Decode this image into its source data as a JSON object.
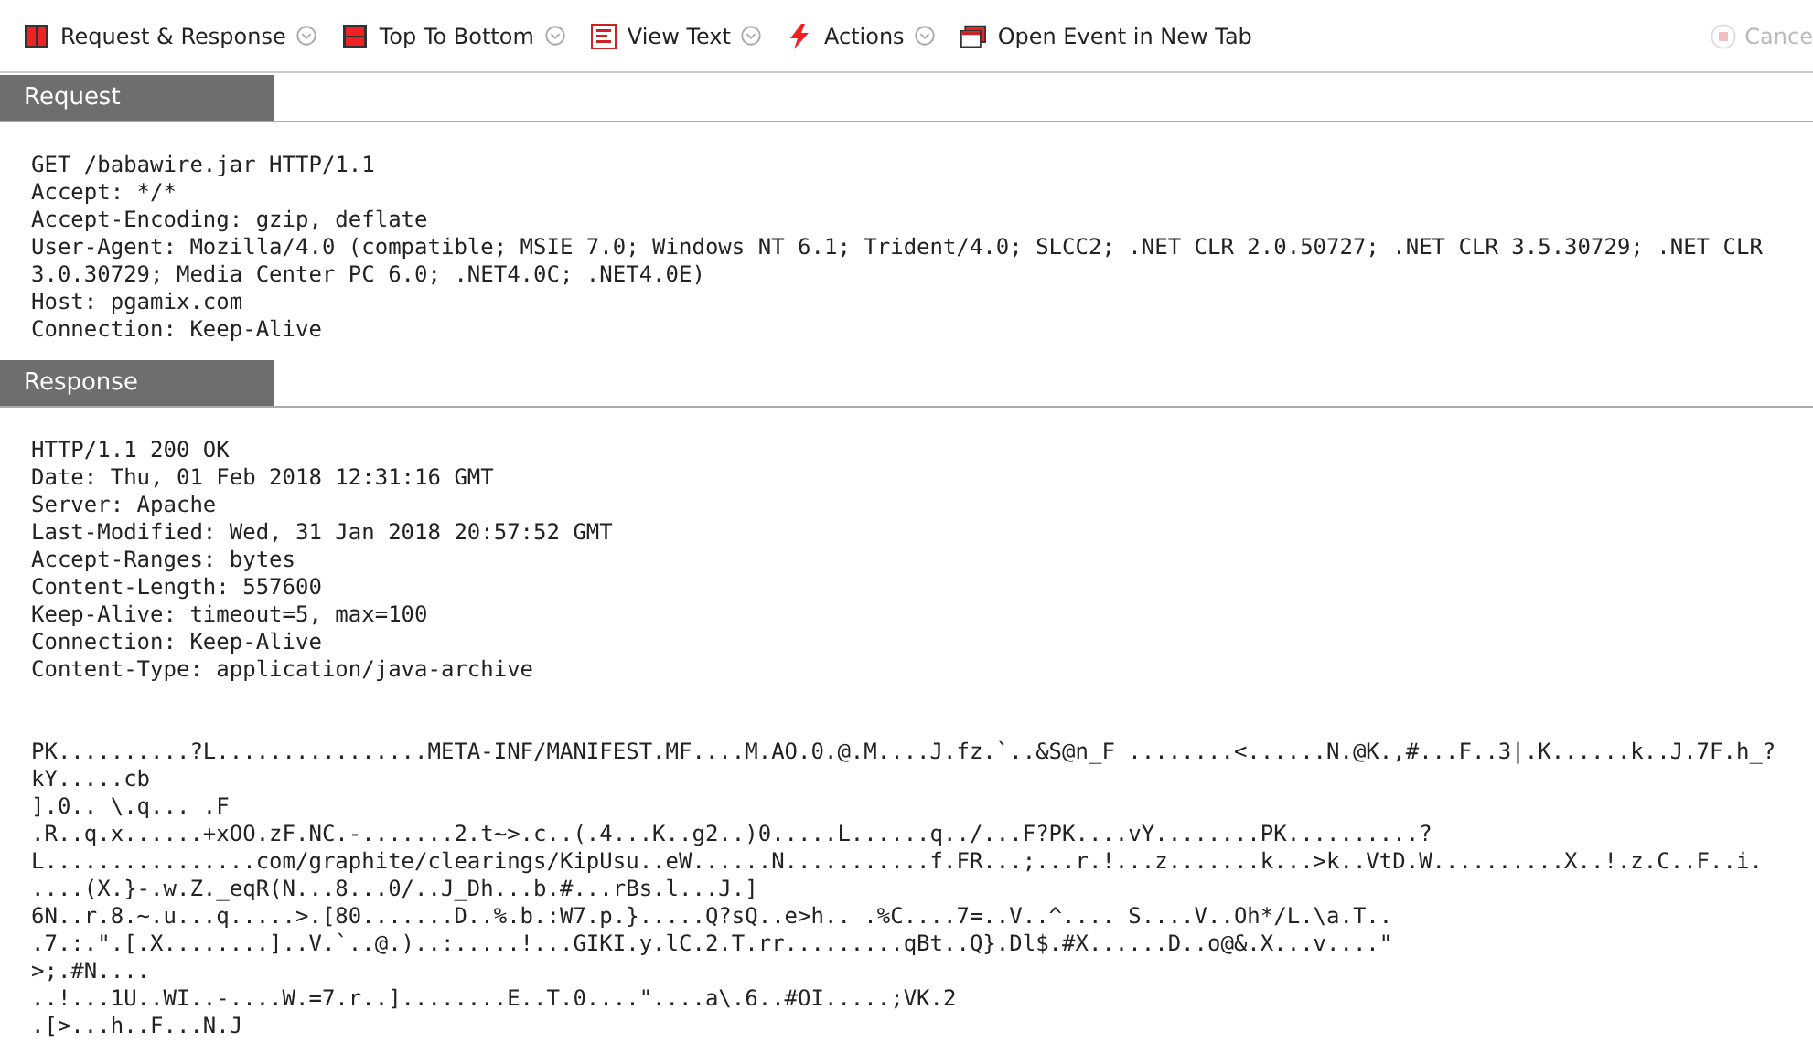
{
  "toolbar": {
    "items": [
      {
        "kind": "split",
        "label": "Request & Response",
        "has_menu": true,
        "disabled": false
      },
      {
        "kind": "rows",
        "label": "Top To Bottom",
        "has_menu": true,
        "disabled": false
      },
      {
        "kind": "text",
        "label": "View Text",
        "has_menu": true,
        "disabled": false
      },
      {
        "kind": "bolt",
        "label": "Actions",
        "has_menu": true,
        "disabled": false
      },
      {
        "kind": "window",
        "label": "Open Event in New Tab",
        "has_menu": false,
        "disabled": false
      }
    ],
    "cancel": {
      "label": "Cance",
      "disabled": true
    }
  },
  "sections": [
    {
      "title": "Request",
      "blocks": [
        [
          "GET /babawire.jar HTTP/1.1",
          "Accept: */*",
          "Accept-Encoding: gzip, deflate",
          "User-Agent: Mozilla/4.0 (compatible; MSIE 7.0; Windows NT 6.1; Trident/4.0; SLCC2; .NET CLR 2.0.50727; .NET CLR 3.5.30729; .NET CLR",
          "3.0.30729; Media Center PC 6.0; .NET4.0C; .NET4.0E)",
          "Host: pgamix.com",
          "Connection: Keep-Alive"
        ]
      ]
    },
    {
      "title": "Response",
      "blocks": [
        [
          "HTTP/1.1 200 OK",
          "Date: Thu, 01 Feb 2018 12:31:16 GMT",
          "Server: Apache",
          "Last-Modified: Wed, 31 Jan 2018 20:57:52 GMT",
          "Accept-Ranges: bytes",
          "Content-Length: 557600",
          "Keep-Alive: timeout=5, max=100",
          "Connection: Keep-Alive",
          "Content-Type: application/java-archive"
        ],
        [
          "PK..........?L................META-INF/MANIFEST.MF....M.AO.0.@.M....J.fz.`..&S@n_F ........<......N.@K.,#...F..3|.K......k..J.7F.h_?",
          "kY.....cb",
          "].0.. \\.q... .F",
          ".R..q.x......+xOO.zF.NC.-.......2.t~>.c..(.4...K..g2..)0.....L......q../...F?PK....vY........PK..........?",
          "L................com/graphite/clearings/KipUsu..eW......N...........f.FR...;...r.!...z.......k...>k..VtD.W..........X..!.z.C..F..i.",
          "....(X.}-.w.Z._eqR(N...8...0/..J_Dh...b.#...rBs.l...J.]",
          "6N..r.8.~.u...q.....>.[80.......D..%.b.:W7.p.}.....Q?sQ..e>h.. .%C....7=..V..^.... S....V..Oh*/L.\\a.T..",
          ".7.:.\".[.X........]..V.`..@.)..:.....!...GIKI.y.lC.2.T.rr.........qBt..Q}.Dl$.#X......D..o@&.X...v....\"",
          ">;.#N....",
          "..!...1U..WI..-....W.=7.r..]........E..T.0....\"....a\\.6..#OI.....;VK.2",
          ".[>...h..F...N.J"
        ]
      ]
    }
  ]
}
